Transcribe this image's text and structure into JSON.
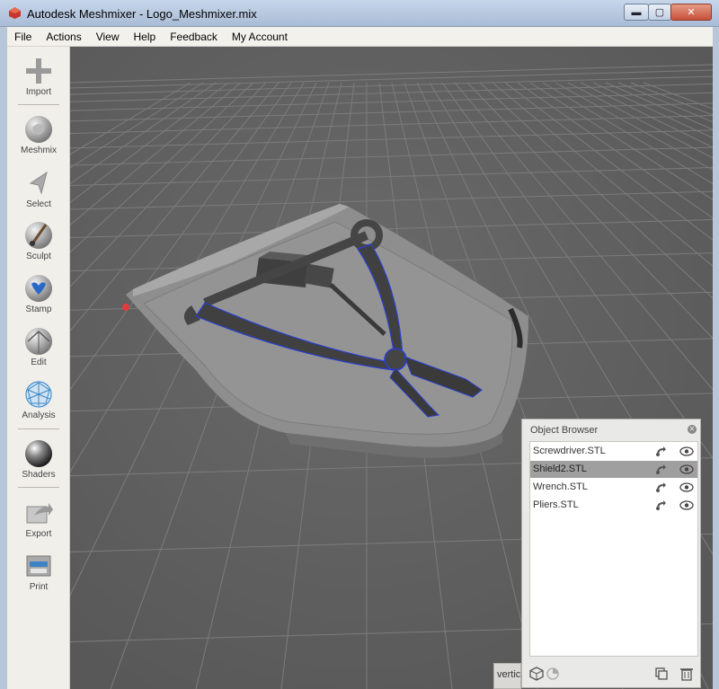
{
  "window": {
    "title": "Autodesk Meshmixer - Logo_Meshmixer.mix",
    "min_glyph": "▬",
    "max_glyph": "▢",
    "close_glyph": "✕"
  },
  "menu": [
    "File",
    "Actions",
    "View",
    "Help",
    "Feedback",
    "My Account"
  ],
  "tools": [
    {
      "label": "Import",
      "icon": "plus-icon"
    },
    {
      "label": "Meshmix",
      "icon": "bunny-sphere-icon"
    },
    {
      "label": "Select",
      "icon": "arrow-cursor-icon"
    },
    {
      "label": "Sculpt",
      "icon": "brush-sphere-icon"
    },
    {
      "label": "Stamp",
      "icon": "stamp-sphere-icon"
    },
    {
      "label": "Edit",
      "icon": "edit-sphere-icon"
    },
    {
      "label": "Analysis",
      "icon": "analysis-sphere-icon"
    },
    {
      "label": "Shaders",
      "icon": "chrome-sphere-icon"
    },
    {
      "label": "Export",
      "icon": "export-icon"
    },
    {
      "label": "Print",
      "icon": "printer-icon"
    }
  ],
  "object_browser": {
    "title": "Object Browser",
    "items": [
      {
        "name": "Screwdriver.STL",
        "selected": false
      },
      {
        "name": "Shield2.STL",
        "selected": true
      },
      {
        "name": "Wrench.STL",
        "selected": false
      },
      {
        "name": "Pliers.STL",
        "selected": false
      }
    ]
  },
  "bottom_tab": "vertic",
  "colors": {
    "viewport_bg": "#5f5f5f",
    "grid": "#7a7a7a",
    "mesh": "#8e8e8e",
    "mesh_dark": "#4b4b4b",
    "selection_outline": "#2233cc",
    "pivot": "#e23b3b"
  }
}
